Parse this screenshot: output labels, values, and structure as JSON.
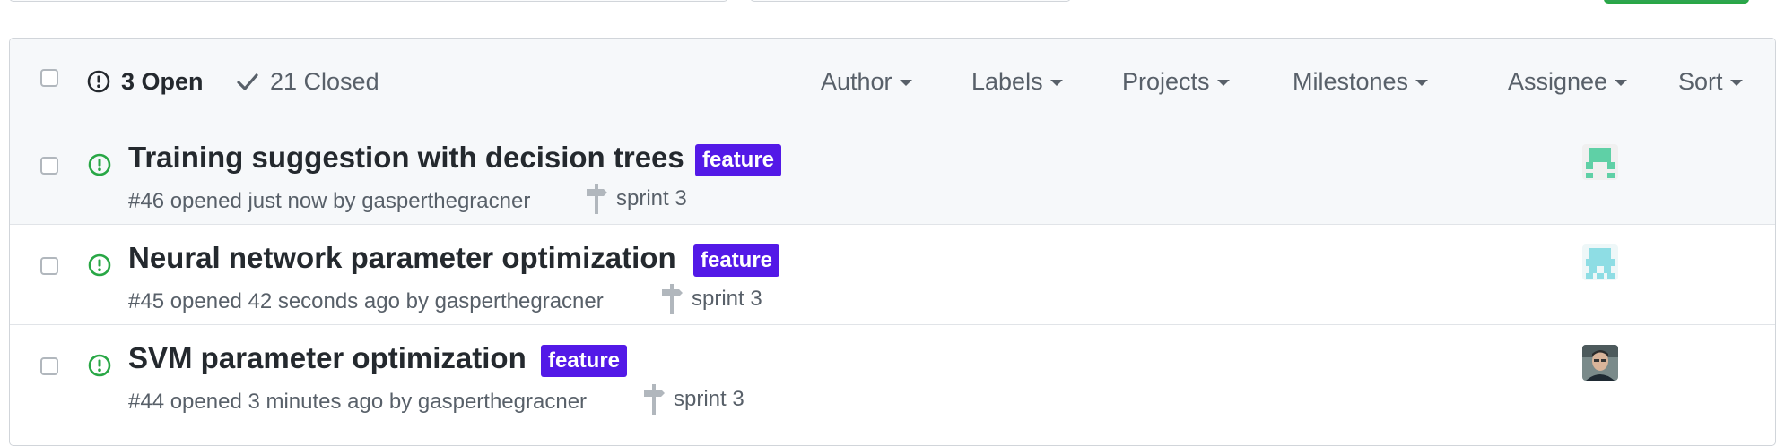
{
  "header": {
    "open_label": "3 Open",
    "closed_label": "21 Closed",
    "filters": [
      "Author",
      "Labels",
      "Projects",
      "Milestones",
      "Assignee",
      "Sort"
    ]
  },
  "colors": {
    "open_icon": "#28a745",
    "label_feature": "#5319e7",
    "avatar_1": "#5fd0a6",
    "avatar_2": "#8edde4"
  },
  "issues": [
    {
      "title": "Training suggestion with decision trees",
      "label": "feature",
      "meta": "#46 opened just now by gasperthegracner",
      "milestone": "sprint 3",
      "avatar": "identicon-green"
    },
    {
      "title": "Neural network parameter optimization",
      "label": "feature",
      "meta": "#45 opened 42 seconds ago by gasperthegracner",
      "milestone": "sprint 3",
      "avatar": "identicon-cyan"
    },
    {
      "title": "SVM parameter optimization",
      "label": "feature",
      "meta": "#44 opened 3 minutes ago by gasperthegracner",
      "milestone": "sprint 3",
      "avatar": "photo-avatar"
    }
  ]
}
